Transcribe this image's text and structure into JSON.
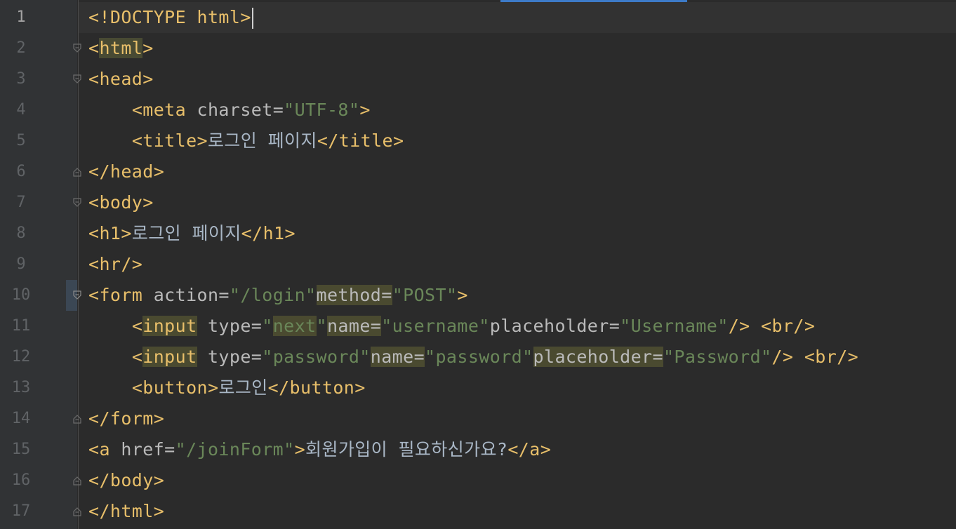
{
  "editor": {
    "language": "HTML",
    "current_line": 1,
    "lines": [
      {
        "n": "1"
      },
      {
        "n": "2"
      },
      {
        "n": "3"
      },
      {
        "n": "4"
      },
      {
        "n": "5"
      },
      {
        "n": "6"
      },
      {
        "n": "7"
      },
      {
        "n": "8"
      },
      {
        "n": "9"
      },
      {
        "n": "10"
      },
      {
        "n": "11"
      },
      {
        "n": "12"
      },
      {
        "n": "13"
      },
      {
        "n": "14"
      },
      {
        "n": "15"
      },
      {
        "n": "16"
      },
      {
        "n": "17"
      }
    ],
    "tokens": {
      "l1_doctype": "<!DOCTYPE html>",
      "l2_open": "<",
      "l2_name": "html",
      "l2_close": ">",
      "l3": "<head>",
      "l4_tag": "<meta",
      "l4_attr": " charset=",
      "l4_val": "\"UTF-8\"",
      "l4_close": ">",
      "l5_open": "<title>",
      "l5_text": "로그인 페이지",
      "l5_close": "</title>",
      "l6": "</head>",
      "l7": "<body>",
      "l8_open": "<h1>",
      "l8_text": "로그인 페이지",
      "l8_close": "</h1>",
      "l9": "<hr/>",
      "l10_tag": "<form",
      "l10_attr1": " action=",
      "l10_val1": "\"/login\"",
      "l10_attr2": "method=",
      "l10_val2": "\"POST\"",
      "l10_close": ">",
      "l11_lt": "<",
      "l11_name": "input",
      "l11_attr1": " type=",
      "l11_val1_q1": "\"",
      "l11_val1": "next",
      "l11_val1_q2": "\"",
      "l11_attr2": "name=",
      "l11_val2": "\"username\"",
      "l11_attr3": "placeholder=",
      "l11_val3": "\"Username\"",
      "l11_end": "/>",
      "l11_br": " <br/>",
      "l12_lt": "<",
      "l12_name": "input",
      "l12_attr1": " type=",
      "l12_val1": "\"password\"",
      "l12_attr2": "name=",
      "l12_val2": "\"password\"",
      "l12_attr3": "placeholder=",
      "l12_val3": "\"Password\"",
      "l12_end": "/>",
      "l12_br": " <br/>",
      "l13_open": "<button>",
      "l13_text": "로그인",
      "l13_close": "</button>",
      "l14": "</form>",
      "l15_tag": "<a",
      "l15_attr": " href=",
      "l15_val": "\"/joinForm\"",
      "l15_gt": ">",
      "l15_text": "회원가입이 필요하신가요?",
      "l15_close": "</a>",
      "l16": "</body>",
      "l17": "</html>"
    }
  },
  "colors": {
    "background": "#2b2b2b",
    "gutter": "#313335",
    "tag": "#e8bf6a",
    "attribute": "#bababa",
    "string": "#6a8759",
    "text": "#a9b7c6",
    "line_number": "#606366",
    "accent": "#3d7bc8"
  }
}
